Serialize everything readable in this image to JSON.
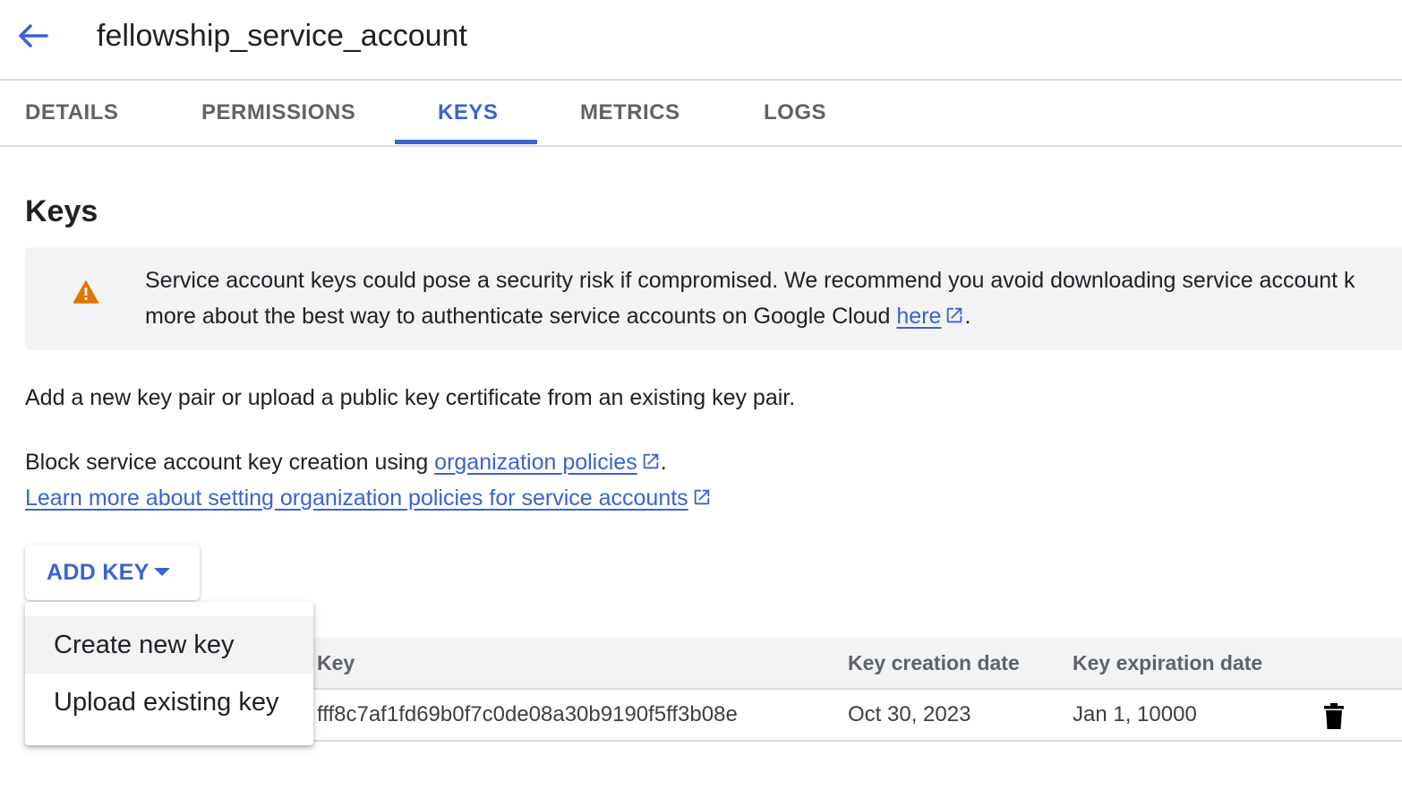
{
  "header": {
    "title": "fellowship_service_account",
    "back_icon": "arrow-back-icon"
  },
  "tabs": [
    {
      "label": "DETAILS",
      "active": false
    },
    {
      "label": "PERMISSIONS",
      "active": false
    },
    {
      "label": "KEYS",
      "active": true
    },
    {
      "label": "METRICS",
      "active": false
    },
    {
      "label": "LOGS",
      "active": false
    }
  ],
  "section": {
    "heading": "Keys"
  },
  "warning": {
    "icon": "warning-icon",
    "line1": "Service account keys could pose a security risk if compromised. We recommend you avoid downloading service account k",
    "line2_prefix": "more about the best way to authenticate service accounts on Google Cloud ",
    "link": "here",
    "suffix": "."
  },
  "description": "Add a new key pair or upload a public key certificate from an existing key pair.",
  "policy": {
    "prefix": "Block service account key creation using ",
    "link": "organization policies",
    "suffix": ".",
    "learn_more": "Learn more about setting organization policies for service accounts"
  },
  "add_key": {
    "label": "ADD KEY",
    "menu": [
      "Create new key",
      "Upload existing key"
    ]
  },
  "table": {
    "columns": [
      "Key",
      "Key creation date",
      "Key expiration date"
    ],
    "rows": [
      {
        "status": "",
        "key": "fff8c7af1fd69b0f7c0de08a30b9190f5ff3b08e",
        "created": "Oct 30, 2023",
        "expires": "Jan 1, 10000",
        "action_icon": "delete-icon"
      }
    ]
  },
  "colors": {
    "accent": "#3b63cf",
    "warning": "#e37400",
    "muted": "#5f6368",
    "panel": "#f1f3f4"
  }
}
